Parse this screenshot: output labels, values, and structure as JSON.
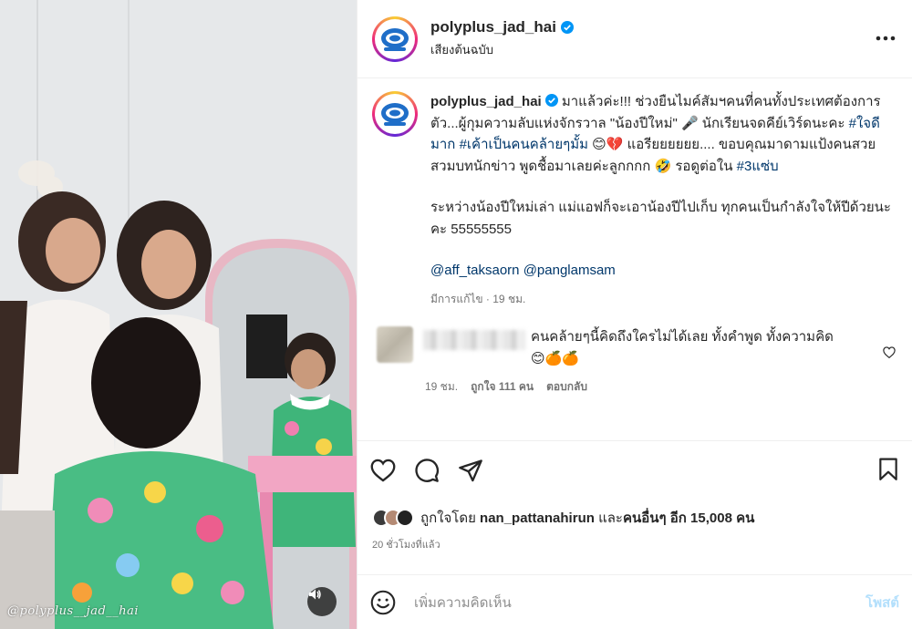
{
  "media": {
    "watermark": "@polyplus__jad__hai"
  },
  "post": {
    "username": "polyplus_jad_hai",
    "subtitle": "เสียงต้นฉบับ",
    "caption_part1": " มาแล้วค่ะ!!! ช่วงยืนไมค์สัมฯคนที่คนทั้งประเทศต้องการตัว...ผู้กุมความลับแห่งจักรวาล \"น้องปีใหม่\" 🎤 นักเรียนจดคีย์เวิร์ดนะคะ ",
    "hashtag1": "#ใจดีมาก",
    "hashtag2": "#เค้าเป็นคนคล้ายๆมั้ม",
    "caption_part2": " 😊💔 แอรียยยยยย.... ขอบคุณมาดามแป้งคนสวยสวมบทนักข่าว พูดชื้อมาเลยค่ะลูกกกก 🤣 รอดูต่อใน ",
    "hashtag3": "#3แซ่บ",
    "caption_line2": "ระหว่างน้องปีใหม่เล่า แม่แอฟก็จะเอาน้องปีไปเก็บ ทุกคนเป็นกำลังใจให้ปีด้วยนะคะ 55555555",
    "mention1": "@aff_taksaorn",
    "mention2": "@panglamsam",
    "caption_meta": "มีการแก้ไข · 19 ชม."
  },
  "comment": {
    "text": "คนคล้ายๆนี้คิดถึงใครไม่ได้เลย ทั้งคำพูด ทั้งความคิด",
    "emojis": "😊🍊🍊",
    "time": "19 ชม.",
    "likes": "ถูกใจ 111 คน",
    "reply": "ตอบกลับ"
  },
  "likes": {
    "prefix": "ถูกใจโดย ",
    "user": "nan_pattanahirun",
    "suffix": " และ",
    "others": "คนอื่นๆ อีก 15,008 คน"
  },
  "timestamp": "20 ชั่วโมงที่แล้ว",
  "add_comment": {
    "placeholder": "เพิ่มความคิดเห็น",
    "post_label": "โพสต์"
  },
  "colors": {
    "link": "#00376b",
    "verified": "#0095f6",
    "post_disabled": "#b2dffc"
  }
}
